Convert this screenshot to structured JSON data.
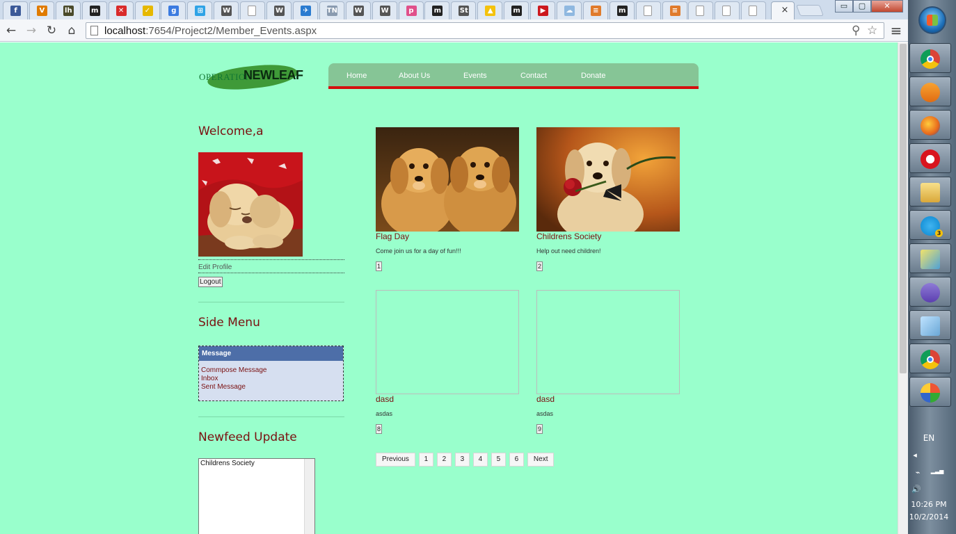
{
  "browser": {
    "url_host": "localhost",
    "url_rest": ":7654/Project2/Member_Events.aspx",
    "window_buttons": {
      "minimize": "▭",
      "restore": "▢",
      "close": "✕"
    },
    "tabs": [
      {
        "icon": "facebook-icon",
        "glyph": "f",
        "color": "#3b5998"
      },
      {
        "icon": "v-site-icon",
        "glyph": "V",
        "color": "#e07b00"
      },
      {
        "icon": "lh-site-icon",
        "glyph": "lh",
        "color": "#4a4a2a"
      },
      {
        "icon": "m-site-icon",
        "glyph": "m",
        "color": "#222222"
      },
      {
        "icon": "x-site-icon",
        "glyph": "✕",
        "color": "#d92b2b"
      },
      {
        "icon": "todo-check-icon",
        "glyph": "✓",
        "color": "#e6b800"
      },
      {
        "icon": "google-icon",
        "glyph": "g",
        "color": "#3b7be0"
      },
      {
        "icon": "windows-store-icon",
        "glyph": "⊞",
        "color": "#2fa3e6"
      },
      {
        "icon": "wikipedia-icon",
        "glyph": "W",
        "color": "#555555"
      },
      {
        "icon": "blank-page-icon",
        "glyph": "",
        "color": "#ffffff"
      },
      {
        "icon": "wikipedia-icon",
        "glyph": "W",
        "color": "#555555"
      },
      {
        "icon": "bird-icon",
        "glyph": "✈",
        "color": "#2a7bd0"
      },
      {
        "icon": "tn-site-icon",
        "glyph": "TN",
        "color": "#8a9bb0"
      },
      {
        "icon": "wikipedia-icon",
        "glyph": "W",
        "color": "#555555"
      },
      {
        "icon": "wikipedia-icon",
        "glyph": "W",
        "color": "#555555"
      },
      {
        "icon": "paint-site-icon",
        "glyph": "p",
        "color": "#e0508a"
      },
      {
        "icon": "m-site-icon",
        "glyph": "m",
        "color": "#222222"
      },
      {
        "icon": "st-site-icon",
        "glyph": "St",
        "color": "#555555"
      },
      {
        "icon": "drive-icon",
        "glyph": "▲",
        "color": "#f4c20d"
      },
      {
        "icon": "m-site-icon",
        "glyph": "m",
        "color": "#222222"
      },
      {
        "icon": "youtube-icon",
        "glyph": "▶",
        "color": "#cc181e"
      },
      {
        "icon": "cloud-site-icon",
        "glyph": "☁",
        "color": "#8fb8e0"
      },
      {
        "icon": "stack-overflow-icon",
        "glyph": "≡",
        "color": "#e07b2c"
      },
      {
        "icon": "m-site-icon",
        "glyph": "m",
        "color": "#222222"
      },
      {
        "icon": "blank-page-icon",
        "glyph": "",
        "color": "#ffffff"
      },
      {
        "icon": "stack-overflow-icon",
        "glyph": "≡",
        "color": "#e07b2c"
      },
      {
        "icon": "blank-page-icon",
        "glyph": "",
        "color": "#ffffff"
      },
      {
        "icon": "blank-page-icon",
        "glyph": "",
        "color": "#ffffff"
      },
      {
        "icon": "blank-page-icon",
        "glyph": "",
        "color": "#ffffff"
      }
    ],
    "active_tab_close": "×",
    "nav_glyphs": {
      "back": "←",
      "forward": "→",
      "reload": "↻",
      "home": "⌂",
      "zoom": "⚲",
      "star": "☆",
      "menu": "≡"
    }
  },
  "logo": {
    "text_operation": "OPERATION",
    "text_newleaf": "NEWLEAF"
  },
  "nav": [
    "Home",
    "About Us",
    "Events",
    "Contact",
    "Donate"
  ],
  "sidebar": {
    "welcome": "Welcome,a",
    "edit_profile": "Edit Profile",
    "logout": "Logout",
    "side_menu_title": "Side Menu",
    "message_header": "Message",
    "message_links": [
      "Commpose Message",
      "Inbox",
      "Sent Message"
    ],
    "newsfeed_title": "Newfeed Update",
    "newsfeed_items": [
      "Childrens Society"
    ]
  },
  "events": [
    {
      "title": "Flag Day",
      "description": "Come join us for a day of fun!!!",
      "id_button": "1",
      "image": "two-puppies"
    },
    {
      "title": "Childrens Society",
      "description": "Help out need children!",
      "id_button": "2",
      "image": "puppy-rose"
    },
    {
      "title": "dasd",
      "description": "asdas",
      "id_button": "8",
      "image": ""
    },
    {
      "title": "dasd",
      "description": "asdas",
      "id_button": "9",
      "image": ""
    }
  ],
  "pager": {
    "previous": "Previous",
    "pages": [
      "1",
      "2",
      "3",
      "4",
      "5",
      "6"
    ],
    "next": "Next"
  },
  "taskbar": {
    "apps": [
      "chrome-icon",
      "media-player-icon",
      "firefox-icon",
      "opera-icon",
      "file-explorer-icon",
      "skype-icon",
      "tools-icon",
      "visual-studio-icon",
      "notepad-icon",
      "chrome-icon",
      "paint-icon"
    ],
    "skype_badge": "3",
    "language": "EN",
    "tray_arrow": "◂",
    "tray_icons": {
      "power": "⌁",
      "network": "▂▃▅",
      "volume": "🔊"
    },
    "time": "10:26 PM",
    "date": "10/2/2014"
  },
  "colors": {
    "page_bg": "#99ffcc",
    "nav_bg": "#86c596",
    "nav_underline": "#d50d0d",
    "heading": "#7a1010",
    "msg_header": "#4d6ea8"
  }
}
